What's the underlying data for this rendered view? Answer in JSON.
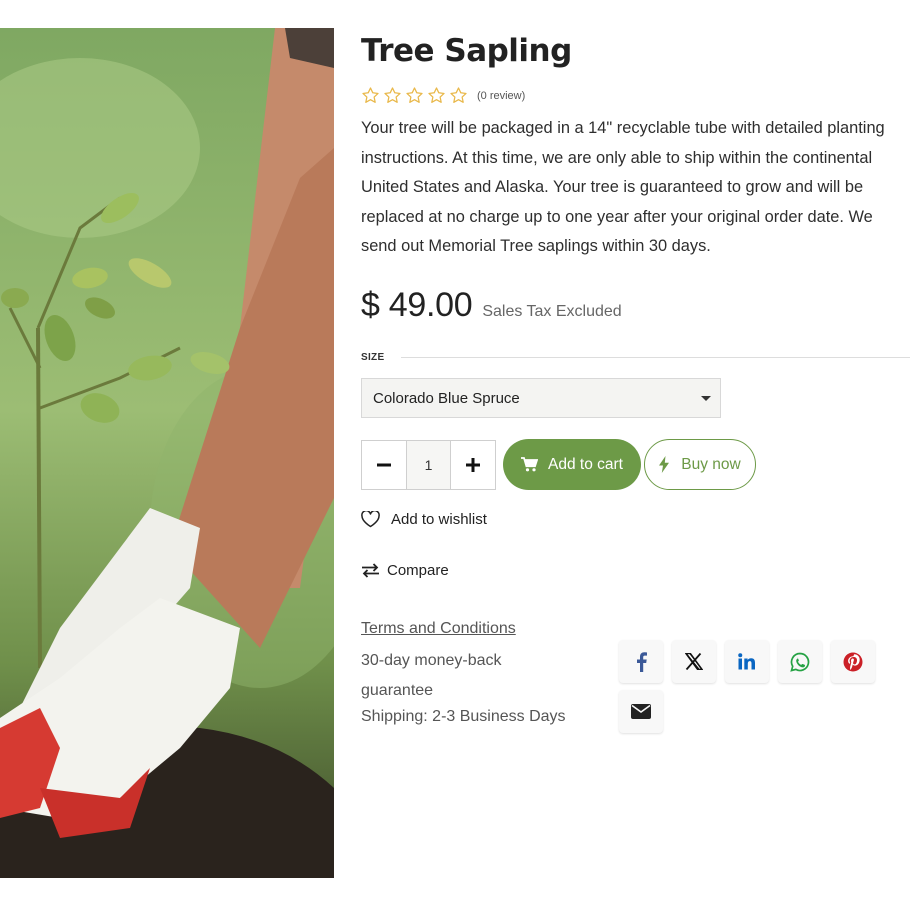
{
  "product": {
    "title": "Tree Sapling",
    "rating_stars": 0,
    "review_count_label": "(0 review)",
    "description": "Your tree will be packaged in a 14\" recyclable tube with detailed planting instructions. At this time, we are only able to ship within the continental United States and Alaska. Your tree is guaranteed to grow and will be replaced at no charge up to one year after your original order date. We send out Memorial Tree saplings within 30 days.",
    "price": "$ 49.00",
    "tax_note": "Sales Tax Excluded"
  },
  "size": {
    "label": "SIZE",
    "selected": "Colorado Blue Spruce"
  },
  "quantity": {
    "minus": "−",
    "value": "1",
    "plus": "+"
  },
  "actions": {
    "add_to_cart": "Add to cart",
    "buy_now": "Buy now",
    "wishlist": "Add to wishlist",
    "compare": "Compare"
  },
  "policies": {
    "terms": "Terms and Conditions",
    "guarantee": "30-day money-back guarantee",
    "shipping": "Shipping: 2-3 Business Days"
  },
  "share": [
    {
      "icon": "facebook-icon",
      "color": "#3b5998"
    },
    {
      "icon": "x-icon",
      "color": "#111111"
    },
    {
      "icon": "linkedin-icon",
      "color": "#0a66c2"
    },
    {
      "icon": "whatsapp-icon",
      "color": "#25a244"
    },
    {
      "icon": "pinterest-icon",
      "color": "#cb2027"
    },
    {
      "icon": "email-icon",
      "color": "#222222"
    }
  ],
  "colors": {
    "accent": "#6d9a47",
    "star": "#e9b84a"
  }
}
